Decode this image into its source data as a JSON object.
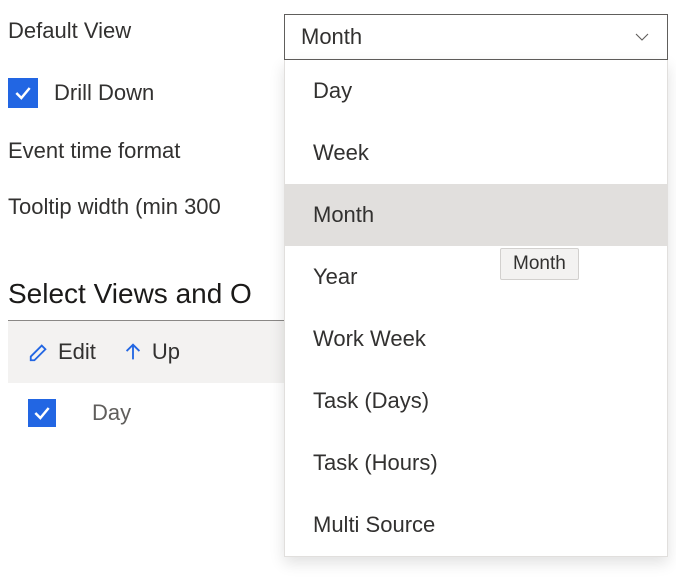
{
  "form": {
    "default_view_label": "Default View",
    "drill_down_label": "Drill Down",
    "drill_down_checked": true,
    "event_time_format_label": "Event time format",
    "tooltip_width_label": "Tooltip width (min 300"
  },
  "section": {
    "title": "Select Views and O"
  },
  "toolbar": {
    "edit_label": "Edit",
    "up_label": "Up"
  },
  "list": {
    "items": [
      {
        "label": "Day",
        "checked": true
      }
    ]
  },
  "dropdown": {
    "selected": "Month",
    "options": [
      {
        "label": "Day",
        "selected": false
      },
      {
        "label": "Week",
        "selected": false
      },
      {
        "label": "Month",
        "selected": true
      },
      {
        "label": "Year",
        "selected": false
      },
      {
        "label": "Work Week",
        "selected": false
      },
      {
        "label": "Task (Days)",
        "selected": false
      },
      {
        "label": "Task (Hours)",
        "selected": false
      },
      {
        "label": "Multi Source",
        "selected": false
      }
    ]
  },
  "tooltip": {
    "text": "Month"
  }
}
